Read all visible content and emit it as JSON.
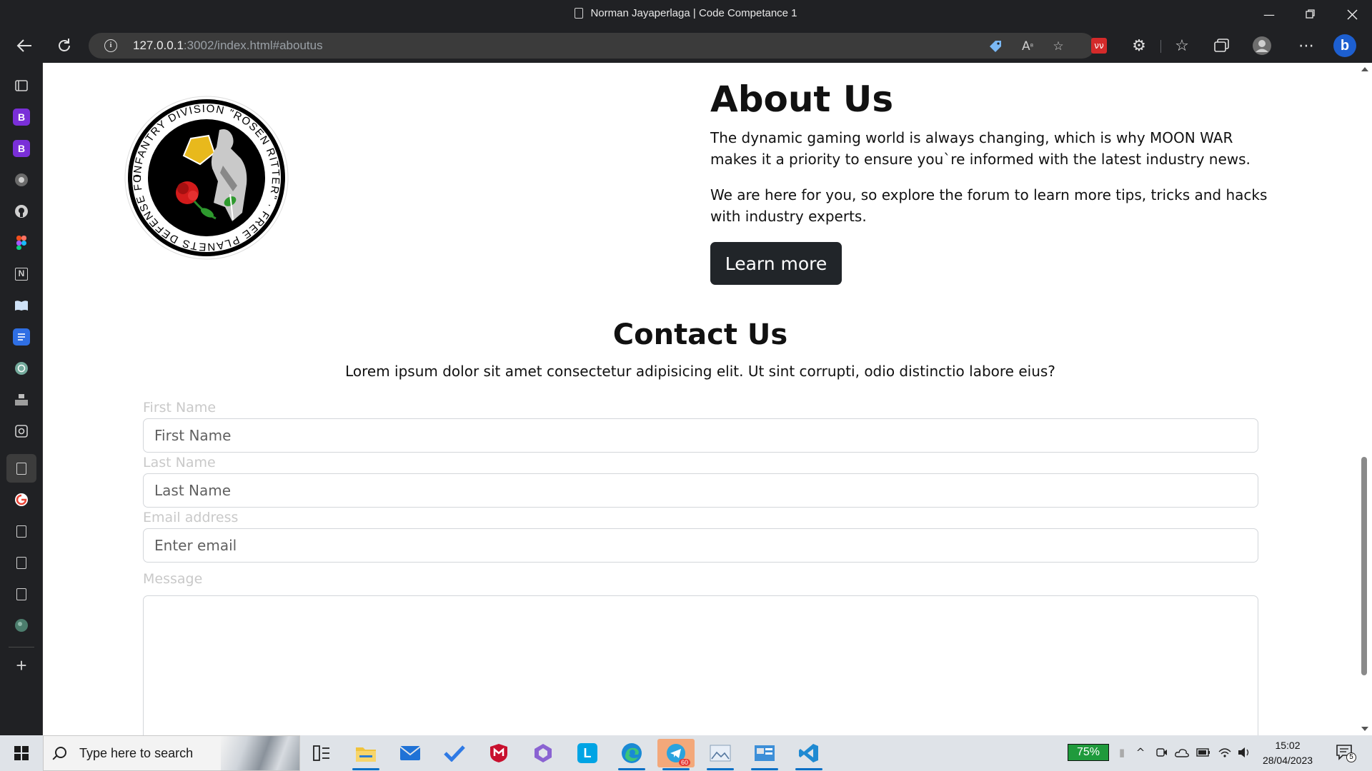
{
  "window": {
    "title": "Norman Jayaperlaga | Code Competance 1"
  },
  "toolbar": {
    "url_host": "127.0.0.1",
    "url_rest": ":3002/index.html#aboutus"
  },
  "about": {
    "title": "About Us",
    "paragraph1": "The dynamic gaming world is always changing, which is why MOON WAR makes it a priority to ensure you`re informed with the latest industry news.",
    "paragraph2": "We are here for you, so explore the forum to learn more tips, tricks and hacks with industry experts.",
    "button_label": "Learn more",
    "logo_text": "INFANTRY DIVISION \"ROSEN RITTER\" · FREE PLANETS DEFENSE FORCE"
  },
  "contact": {
    "title": "Contact Us",
    "subtitle": "Lorem ipsum dolor sit amet consectetur adipisicing elit. Ut sint corrupti, odio distinctio labore eius?",
    "first_name_label": "First Name",
    "first_name_placeholder": "First Name",
    "last_name_label": "Last Name",
    "last_name_placeholder": "Last Name",
    "email_label": "Email address",
    "email_placeholder": "Enter email",
    "message_label": "Message"
  },
  "taskbar": {
    "search_placeholder": "Type here to search",
    "battery": "75%",
    "time": "15:02",
    "date": "28/04/2023",
    "telegram_badge": "60",
    "notification_count": "5"
  },
  "colors": {
    "chrome_dark": "#202124",
    "button_dark": "#212529",
    "taskbar": "#dfe3e8"
  }
}
